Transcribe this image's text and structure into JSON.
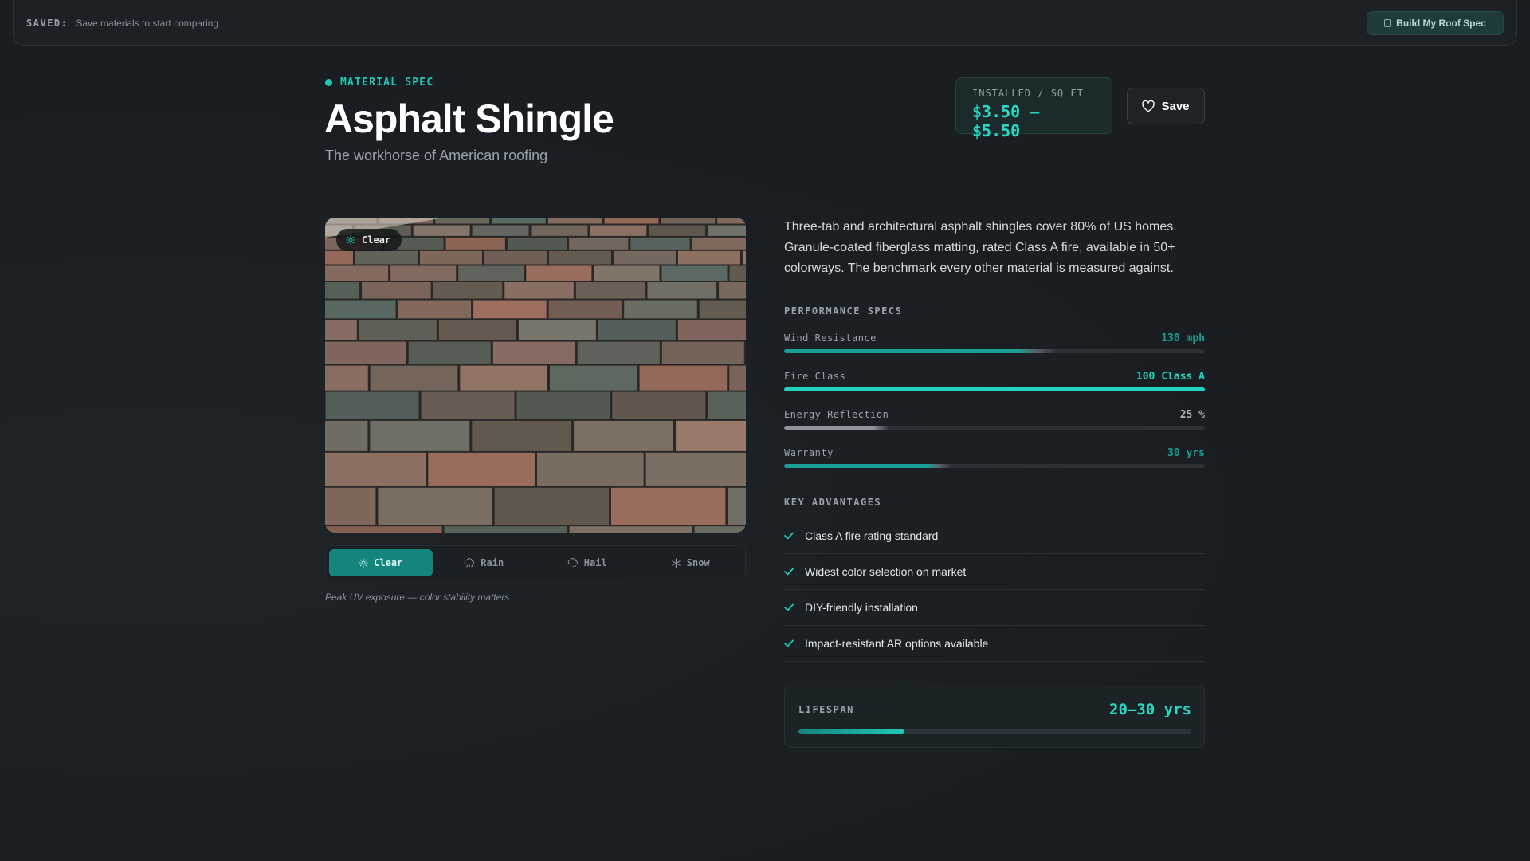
{
  "topbar": {
    "saved_label": "SAVED:",
    "saved_text": "Save materials to start comparing",
    "build_button": "Build My Roof Spec"
  },
  "header": {
    "eyebrow": "MATERIAL SPEC",
    "title": "Asphalt Shingle",
    "subtitle": "The workhorse of American roofing",
    "price_label": "INSTALLED / SQ FT",
    "price_value": "$3.50 – $5.50",
    "save_button": "Save"
  },
  "image": {
    "badge": "Clear",
    "badge_icon": "sun-icon"
  },
  "weather_tabs": [
    {
      "label": "Clear",
      "icon": "sun-icon",
      "active": true
    },
    {
      "label": "Rain",
      "icon": "cloud-rain-icon",
      "active": false
    },
    {
      "label": "Hail",
      "icon": "cloud-hail-icon",
      "active": false
    },
    {
      "label": "Snow",
      "icon": "snowflake-icon",
      "active": false
    }
  ],
  "caption": "Peak UV exposure — color stability matters",
  "description": "Three-tab and architectural asphalt shingles cover 80% of US homes. Granule-coated fiberglass matting, rated Class A fire, available in 50+ colorways. The benchmark every other material is measured against.",
  "performance": {
    "label": "PERFORMANCE SPECS",
    "specs": [
      {
        "name": "Wind Resistance",
        "value": "130 mph",
        "level": 0.65,
        "color": "#1a9f94"
      },
      {
        "name": "Fire Class",
        "value": "100 Class A",
        "level": 1.0,
        "color": "#22d3c0"
      },
      {
        "name": "Energy Reflection",
        "value": "25 %",
        "level": 0.25,
        "color": "#8e969c"
      },
      {
        "name": "Warranty",
        "value": "30 yrs",
        "level": 0.4,
        "color": "#1a9f94"
      }
    ]
  },
  "advantages": {
    "label": "KEY ADVANTAGES",
    "items": [
      "Class A fire rating standard",
      "Widest color selection on market",
      "DIY-friendly installation",
      "Impact-resistant AR options available"
    ]
  },
  "lifespan": {
    "label": "LIFESPAN",
    "value": "20–30 yrs",
    "level": 0.27
  },
  "colors": {
    "accent": "#22c7b6",
    "background": "#1a1e22"
  }
}
